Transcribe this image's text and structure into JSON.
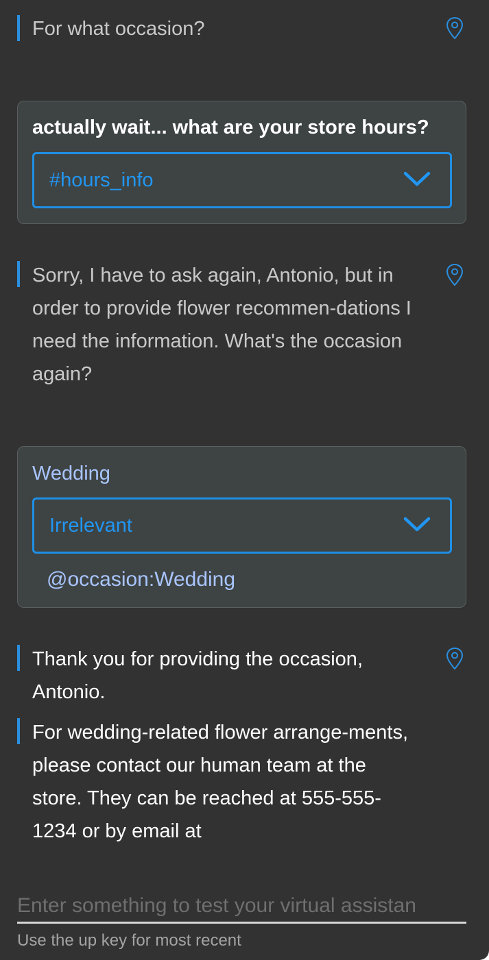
{
  "conversation": {
    "bot_message_1": "For what occasion?",
    "user_message_1": {
      "text": "actually wait... what are your store hours?",
      "intent": "#hours_info"
    },
    "bot_message_2": "Sorry, I have to ask again, Antonio, but in order to provide flower recommen-dations I need the information. What's the occasion again?",
    "user_message_2": {
      "text": "Wedding",
      "intent": "Irrelevant",
      "entity": "@occasion:Wedding"
    },
    "bot_message_3": "Thank you for providing the occasion, Antonio.",
    "bot_message_4": "For wedding-related flower arrange-ments, please contact our human team at the store. They can be reached at 555-555-1234 or by email at"
  },
  "input": {
    "placeholder": "Enter something to test your virtual assistan",
    "hint": "Use the up key for most recent"
  },
  "colors": {
    "background": "#323232",
    "accent": "#2a8fe0",
    "entity": "#a9c5ff"
  },
  "icons": {
    "location": "location-pin-icon",
    "dropdown": "chevron-down-icon"
  }
}
